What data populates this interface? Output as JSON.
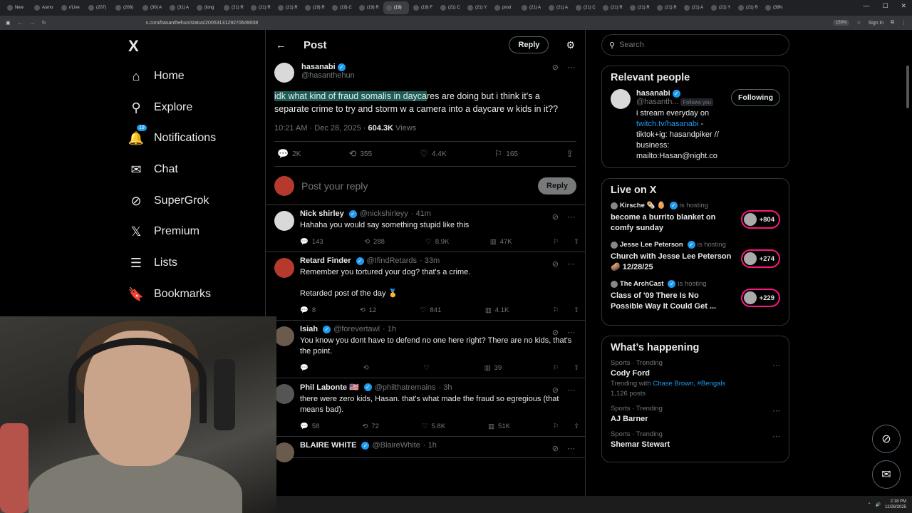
{
  "browser": {
    "tabs": [
      "New",
      "Asmo",
      "r/Live",
      "(207)",
      "(208)",
      "(30) A",
      "(31) A",
      "(long",
      "(21) R",
      "(21) R",
      "(21) R",
      "(19) R",
      "(19) C",
      "(19) R",
      "(19)",
      "(19) F",
      "(21) C",
      "(21) Y",
      "prod",
      "(21) A",
      "(21) A",
      "(21) C",
      "(21) R",
      "(21) R",
      "(21) R",
      "(21) A",
      "(21) Y",
      "(21) R",
      "(39N"
    ],
    "url": "x.com/hasanthehun/status/2005313129270649008",
    "zoom": "150%",
    "profile_label": "Sign in"
  },
  "nav": {
    "logo": "X",
    "items": [
      {
        "label": "Home",
        "icon": "home-icon",
        "glyph": "⌂"
      },
      {
        "label": "Explore",
        "icon": "search-icon",
        "glyph": "⚲"
      },
      {
        "label": "Notifications",
        "icon": "bell-icon",
        "glyph": "🔔"
      },
      {
        "label": "Chat",
        "icon": "mail-icon",
        "glyph": "✉"
      },
      {
        "label": "SuperGrok",
        "icon": "grok-icon",
        "glyph": "⊘"
      },
      {
        "label": "Premium",
        "icon": "x-logo-icon",
        "glyph": "𝕏"
      },
      {
        "label": "Lists",
        "icon": "list-icon",
        "glyph": "☰"
      },
      {
        "label": "Bookmarks",
        "icon": "bookmark-icon",
        "glyph": "🔖"
      }
    ],
    "notif_badge": "19"
  },
  "header": {
    "title": "Post",
    "reply_button": "Reply"
  },
  "post": {
    "name": "hasanabi",
    "handle": "@hasanthehun",
    "text_highlight": "idk what kind of fraud somalis in dayca",
    "text_rest": "res are doing but i think it’s a separate crime to try and storm w a camera into a daycare w kids in it??",
    "time": "10:21 AM · Dec 28, 2025 · ",
    "views": "604.3K",
    "views_label": " Views",
    "stats": {
      "replies": "2K",
      "reposts": "355",
      "likes": "4.4K",
      "bookmarks": "165"
    }
  },
  "compose": {
    "placeholder": "Post your reply",
    "button": "Reply"
  },
  "replies": [
    {
      "name": "Nick shirley",
      "handle": "@nickshirleyy",
      "time": "· 41m",
      "text": "Hahaha you would say something stupid like this",
      "replies": "143",
      "reposts": "288",
      "likes": "8.9K",
      "views": "47K",
      "av": "light"
    },
    {
      "name": "Retard Finder",
      "handle": "@IfindRetards",
      "time": "· 33m",
      "text": "Remember you tortured your dog? that's a crime.\n\nRetarded post of the day 🥇",
      "replies": "8",
      "reposts": "12",
      "likes": "841",
      "views": "4.1K",
      "av": "red"
    },
    {
      "name": "Isiah",
      "handle": "@forevertawl",
      "time": "· 1h",
      "text": "You know you dont have to defend no one here right? There are no kids, that's the point.",
      "replies": "",
      "reposts": "",
      "likes": "",
      "views": "39",
      "av": "dark"
    },
    {
      "name": "Phil Labonte 🇺🇸",
      "handle": "@philthatremains",
      "time": "· 3h",
      "text": "there were zero kids, Hasan. that's what made the fraud so egregious (that means bad).",
      "replies": "58",
      "reposts": "72",
      "likes": "5.8K",
      "views": "51K",
      "av": "grey"
    },
    {
      "name": "BLAIRE WHITE",
      "handle": "@BlaireWhite",
      "time": "· 1h",
      "text": "",
      "replies": "",
      "reposts": "",
      "likes": "",
      "views": "",
      "av": "dark"
    }
  ],
  "sidebar": {
    "search_placeholder": "Search",
    "relevant": {
      "title": "Relevant people",
      "name": "hasanabi",
      "handle": "@hasanth...",
      "follows_you": "Follows you",
      "button": "Following",
      "bio_1": "i stream everyday on ",
      "bio_link": "twitch.tv/hasanabi",
      "bio_2": " - tiktok+ig: hasandpiker // business: mailto:Hasan@night.co"
    },
    "live": {
      "title": "Live on X",
      "items": [
        {
          "host": "Kirsche 🌯 🥚",
          "status": "is hosting",
          "title": "become a burrito blanket on comfy sunday",
          "count": "+804"
        },
        {
          "host": "Jesse Lee Peterson",
          "status": "is hosting",
          "title": "Church with Jesse Lee Peterson 🥔 12/28/25",
          "count": "+274"
        },
        {
          "host": "The ArchCast",
          "status": "is hosting",
          "title": "Class of '09 There Is No Possible Way It Could Get ...",
          "count": "+229"
        }
      ]
    },
    "happening": {
      "title": "What’s happening",
      "items": [
        {
          "cat": "Sports · Trending",
          "name": "Cody Ford",
          "sub_prefix": "Trending with ",
          "sub_links": "Chase Brown, #Bengals",
          "posts": "1,126 posts"
        },
        {
          "cat": "Sports · Trending",
          "name": "AJ Barner",
          "sub_prefix": "",
          "sub_links": "",
          "posts": ""
        },
        {
          "cat": "Sports · Trending",
          "name": "Shemar Stewart",
          "sub_prefix": "",
          "sub_links": "",
          "posts": ""
        }
      ]
    }
  },
  "taskbar": {
    "time": "2:18 PM",
    "date": "12/28/2025"
  }
}
